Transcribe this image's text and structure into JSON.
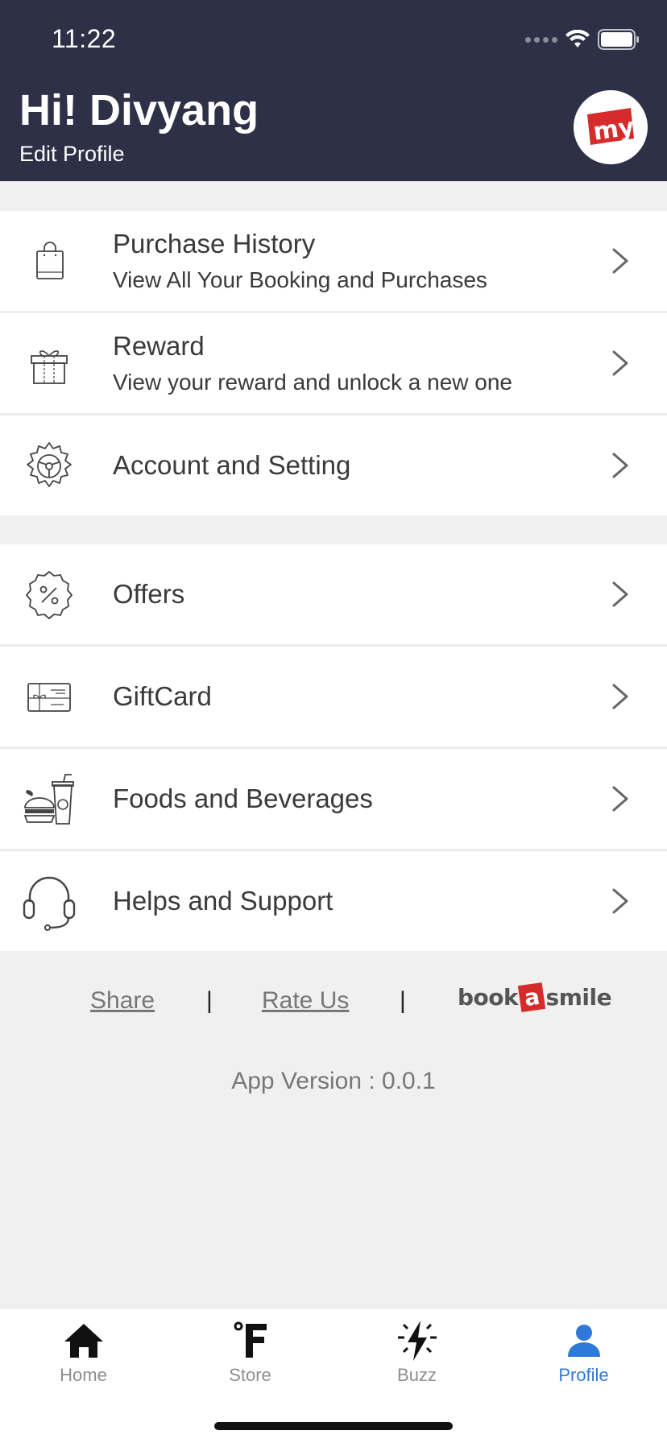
{
  "status_bar": {
    "time": "11:22"
  },
  "header": {
    "greeting": "Hi! Divyang",
    "edit_profile": "Edit Profile",
    "logo_text": "my",
    "logo_color": "#d62b2b",
    "background": "#2d3046"
  },
  "menu_group_1": [
    {
      "icon": "shopping-bag-icon",
      "title": "Purchase History",
      "subtitle": "View All Your Booking and Purchases"
    },
    {
      "icon": "gift-box-icon",
      "title": "Reward",
      "subtitle": "View your reward and unlock a new one"
    },
    {
      "icon": "settings-gear-icon",
      "title": "Account and Setting",
      "subtitle": ""
    }
  ],
  "menu_group_2": [
    {
      "icon": "offer-badge-icon",
      "title": "Offers"
    },
    {
      "icon": "gift-card-icon",
      "title": "GiftCard"
    },
    {
      "icon": "food-beverage-icon",
      "title": "Foods and Beverages"
    },
    {
      "icon": "headset-icon",
      "title": "Helps and Support"
    }
  ],
  "footer": {
    "share": "Share",
    "rate_us": "Rate Us",
    "separator": "|",
    "brand_book": "book",
    "brand_a": "a",
    "brand_smile": "smile",
    "app_version": "App Version : 0.0.1"
  },
  "tabbar": {
    "active_color": "#2f7ad8",
    "tabs": [
      {
        "label": "Home",
        "icon": "home-icon"
      },
      {
        "label": "Store",
        "icon": "store-fahrenheit-icon"
      },
      {
        "label": "Buzz",
        "icon": "buzz-lightning-icon"
      },
      {
        "label": "Profile",
        "icon": "profile-person-icon"
      }
    ]
  }
}
